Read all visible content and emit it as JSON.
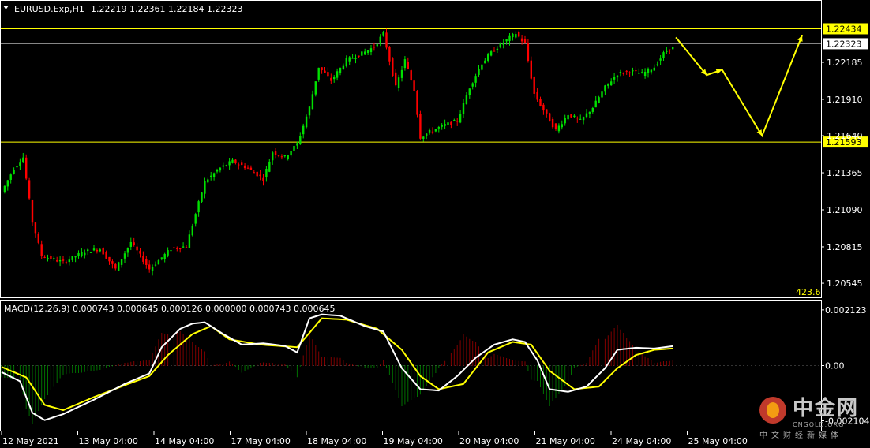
{
  "header": {
    "symbol": "EURUSD.Exp,H1",
    "ohlc": "1.22219 1.22361 1.22184 1.22323"
  },
  "macd": {
    "label": "MACD(12,26,9) 0.000743 0.000645 0.000126 0.000000 0.000743 0.000645"
  },
  "right_info": "423.6",
  "watermark": {
    "cn": "中金网",
    "en": "CNGOLD.ORG",
    "sub": "中文财经新媒体"
  },
  "colors": {
    "background": "#000000",
    "bull": "#00e000",
    "bear": "#ff0000",
    "level_line": "#ffff00",
    "macd_line": "#ffffff",
    "signal_line": "#ffff00",
    "grid_border": "#ffffff"
  },
  "chart_data": [
    {
      "type": "candlestick",
      "title": "EURUSD.Exp,H1",
      "y_ticks": [
        "1.22185",
        "1.21910",
        "1.21640",
        "1.21365",
        "1.21090",
        "1.20815",
        "1.20545"
      ],
      "ylim": [
        1.2044,
        1.2263
      ],
      "x_ticks": [
        "12 May 2021",
        "13 May 04:00",
        "14 May 04:00",
        "17 May 04:00",
        "18 May 04:00",
        "19 May 04:00",
        "20 May 04:00",
        "21 May 04:00",
        "24 May 04:00",
        "25 May 04:00"
      ],
      "levels": [
        {
          "value": 1.22434,
          "label": "1.22434"
        },
        {
          "value": 1.22323,
          "label": "1.22323"
        },
        {
          "value": 1.21593,
          "label": "1.21593"
        }
      ],
      "anchors": [
        [
          0,
          1.2122
        ],
        [
          4,
          1.214
        ],
        [
          7,
          1.2148
        ],
        [
          10,
          1.21
        ],
        [
          13,
          1.2075
        ],
        [
          20,
          1.207
        ],
        [
          27,
          1.2078
        ],
        [
          32,
          1.208
        ],
        [
          37,
          1.2065
        ],
        [
          42,
          1.2085
        ],
        [
          48,
          1.2065
        ],
        [
          55,
          1.208
        ],
        [
          60,
          1.2082
        ],
        [
          66,
          1.213
        ],
        [
          71,
          1.214
        ],
        [
          75,
          1.2145
        ],
        [
          80,
          1.214
        ],
        [
          85,
          1.2132
        ],
        [
          88,
          1.2152
        ],
        [
          92,
          1.2148
        ],
        [
          96,
          1.2158
        ],
        [
          100,
          1.2185
        ],
        [
          103,
          1.2215
        ],
        [
          107,
          1.2205
        ],
        [
          112,
          1.222
        ],
        [
          117,
          1.2225
        ],
        [
          121,
          1.223
        ],
        [
          124,
          1.224
        ],
        [
          128,
          1.22
        ],
        [
          131,
          1.222
        ],
        [
          134,
          1.2198
        ],
        [
          136,
          1.2163
        ],
        [
          140,
          1.2168
        ],
        [
          144,
          1.2172
        ],
        [
          148,
          1.2175
        ],
        [
          152,
          1.22
        ],
        [
          156,
          1.2218
        ],
        [
          160,
          1.2228
        ],
        [
          164,
          1.2235
        ],
        [
          167,
          1.224
        ],
        [
          170,
          1.2232
        ],
        [
          173,
          1.2195
        ],
        [
          176,
          1.2183
        ],
        [
          180,
          1.2168
        ],
        [
          184,
          1.218
        ],
        [
          188,
          1.2175
        ],
        [
          192,
          1.2185
        ],
        [
          196,
          1.22
        ],
        [
          200,
          1.221
        ],
        [
          204,
          1.2212
        ],
        [
          208,
          1.221
        ],
        [
          212,
          1.2215
        ],
        [
          215,
          1.2225
        ],
        [
          217,
          1.2229
        ]
      ],
      "projection": [
        [
          219,
          1.2237
        ],
        [
          229,
          1.2209
        ],
        [
          234,
          1.2213
        ],
        [
          247,
          1.2164
        ],
        [
          260,
          1.22385
        ]
      ]
    },
    {
      "type": "histogram+line",
      "title": "MACD(12,26,9)",
      "y_ticks": [
        "0.002123",
        "0.00",
        "-0.002104"
      ],
      "ylim": [
        -0.00245,
        0.00245
      ],
      "series": [
        {
          "name": "MACD",
          "anchors": [
            [
              0,
              -0.00025
            ],
            [
              6,
              -0.0006
            ],
            [
              10,
              -0.0018
            ],
            [
              14,
              -0.00208
            ],
            [
              20,
              -0.00185
            ],
            [
              30,
              -0.0013
            ],
            [
              40,
              -0.0007
            ],
            [
              48,
              -0.0003
            ],
            [
              52,
              0.0007
            ],
            [
              58,
              0.0014
            ],
            [
              62,
              0.0016
            ],
            [
              66,
              0.00165
            ],
            [
              72,
              0.0012
            ],
            [
              78,
              0.0008
            ],
            [
              85,
              0.00085
            ],
            [
              92,
              0.00075
            ],
            [
              96,
              0.0005
            ],
            [
              100,
              0.0018
            ],
            [
              104,
              0.00195
            ],
            [
              110,
              0.0019
            ],
            [
              118,
              0.0015
            ],
            [
              124,
              0.0013
            ],
            [
              130,
              -0.0001
            ],
            [
              136,
              -0.0009
            ],
            [
              142,
              -0.00095
            ],
            [
              148,
              -0.0004
            ],
            [
              154,
              0.0003
            ],
            [
              160,
              0.0008
            ],
            [
              166,
              0.001
            ],
            [
              170,
              0.0009
            ],
            [
              174,
              0.0002
            ],
            [
              178,
              -0.0009
            ],
            [
              184,
              -0.001
            ],
            [
              190,
              -0.0008
            ],
            [
              196,
              -0.0001
            ],
            [
              200,
              0.0006
            ],
            [
              206,
              0.00068
            ],
            [
              212,
              0.00065
            ],
            [
              218,
              0.00074
            ]
          ]
        },
        {
          "name": "Signal",
          "anchors": [
            [
              0,
              -5e-05
            ],
            [
              8,
              -0.00045
            ],
            [
              14,
              -0.0015
            ],
            [
              20,
              -0.0017
            ],
            [
              30,
              -0.0012
            ],
            [
              40,
              -0.00075
            ],
            [
              48,
              -0.0004
            ],
            [
              54,
              0.0004
            ],
            [
              62,
              0.0012
            ],
            [
              68,
              0.0015
            ],
            [
              74,
              0.001
            ],
            [
              84,
              0.0008
            ],
            [
              96,
              0.0007
            ],
            [
              104,
              0.0018
            ],
            [
              112,
              0.00175
            ],
            [
              122,
              0.0014
            ],
            [
              130,
              0.0006
            ],
            [
              136,
              -0.0004
            ],
            [
              142,
              -0.0009
            ],
            [
              150,
              -0.0007
            ],
            [
              158,
              0.0005
            ],
            [
              166,
              0.0009
            ],
            [
              172,
              0.0008
            ],
            [
              178,
              -0.0002
            ],
            [
              186,
              -0.0009
            ],
            [
              194,
              -0.0008
            ],
            [
              200,
              -0.0001
            ],
            [
              206,
              0.0004
            ],
            [
              212,
              0.0006
            ],
            [
              218,
              0.00065
            ]
          ]
        }
      ]
    }
  ]
}
